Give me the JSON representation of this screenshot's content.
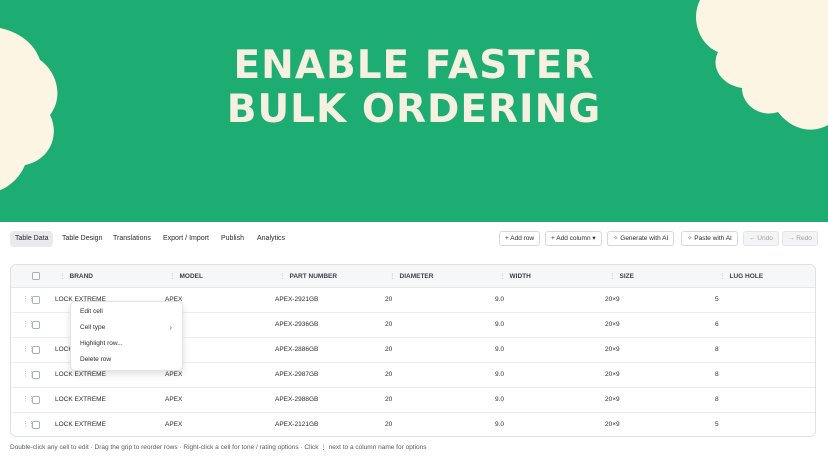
{
  "hero": {
    "title_line1": "ENABLE FASTER",
    "title_line2": "BULK ORDERING",
    "background": "#1dac72",
    "blob_color": "#fcf5e4"
  },
  "tabs": [
    {
      "label": "Table Data",
      "active": true
    },
    {
      "label": "Table Design",
      "active": false
    },
    {
      "label": "Translations",
      "active": false
    },
    {
      "label": "Export / Import",
      "active": false
    },
    {
      "label": "Publish",
      "active": false
    },
    {
      "label": "Analytics",
      "active": false
    }
  ],
  "actions": {
    "add_row": "+ Add row",
    "add_column": "+ Add column ▾",
    "generate_ai": "Generate with AI",
    "paste_ai": "Paste with AI",
    "undo": "← Undo",
    "redo": "→ Redo"
  },
  "table": {
    "columns": [
      "BRAND",
      "MODEL",
      "PART NUMBER",
      "DIAMETER",
      "WIDTH",
      "SIZE",
      "LUG HOLE"
    ],
    "rows": [
      [
        "LOCK EXTREME",
        "APEX",
        "APEX-2921GB",
        "20",
        "9.0",
        "20×9",
        "5"
      ],
      [
        "",
        "",
        "APEX-2936GB",
        "20",
        "9.0",
        "20×9",
        "6"
      ],
      [
        "LOCK",
        "",
        "APEX-2886GB",
        "20",
        "9.0",
        "20×9",
        "8"
      ],
      [
        "LOCK EXTREME",
        "APEX",
        "APEX-2987GB",
        "20",
        "9.0",
        "20×9",
        "8"
      ],
      [
        "LOCK EXTREME",
        "APEX",
        "APEX-2988GB",
        "20",
        "9.0",
        "20×9",
        "8"
      ],
      [
        "LOCK EXTREME",
        "APEX",
        "APEX-2121GB",
        "20",
        "9.0",
        "20×9",
        "5"
      ]
    ]
  },
  "context_menu": {
    "items": [
      "Edit cell",
      "Cell type",
      "Highlight row...",
      "Delete row"
    ]
  },
  "hint": "Double-click any cell to edit · Drag the grip to reorder rows · Right-click a cell for tone / rating options · Click  ⋮  next to a column name for options"
}
